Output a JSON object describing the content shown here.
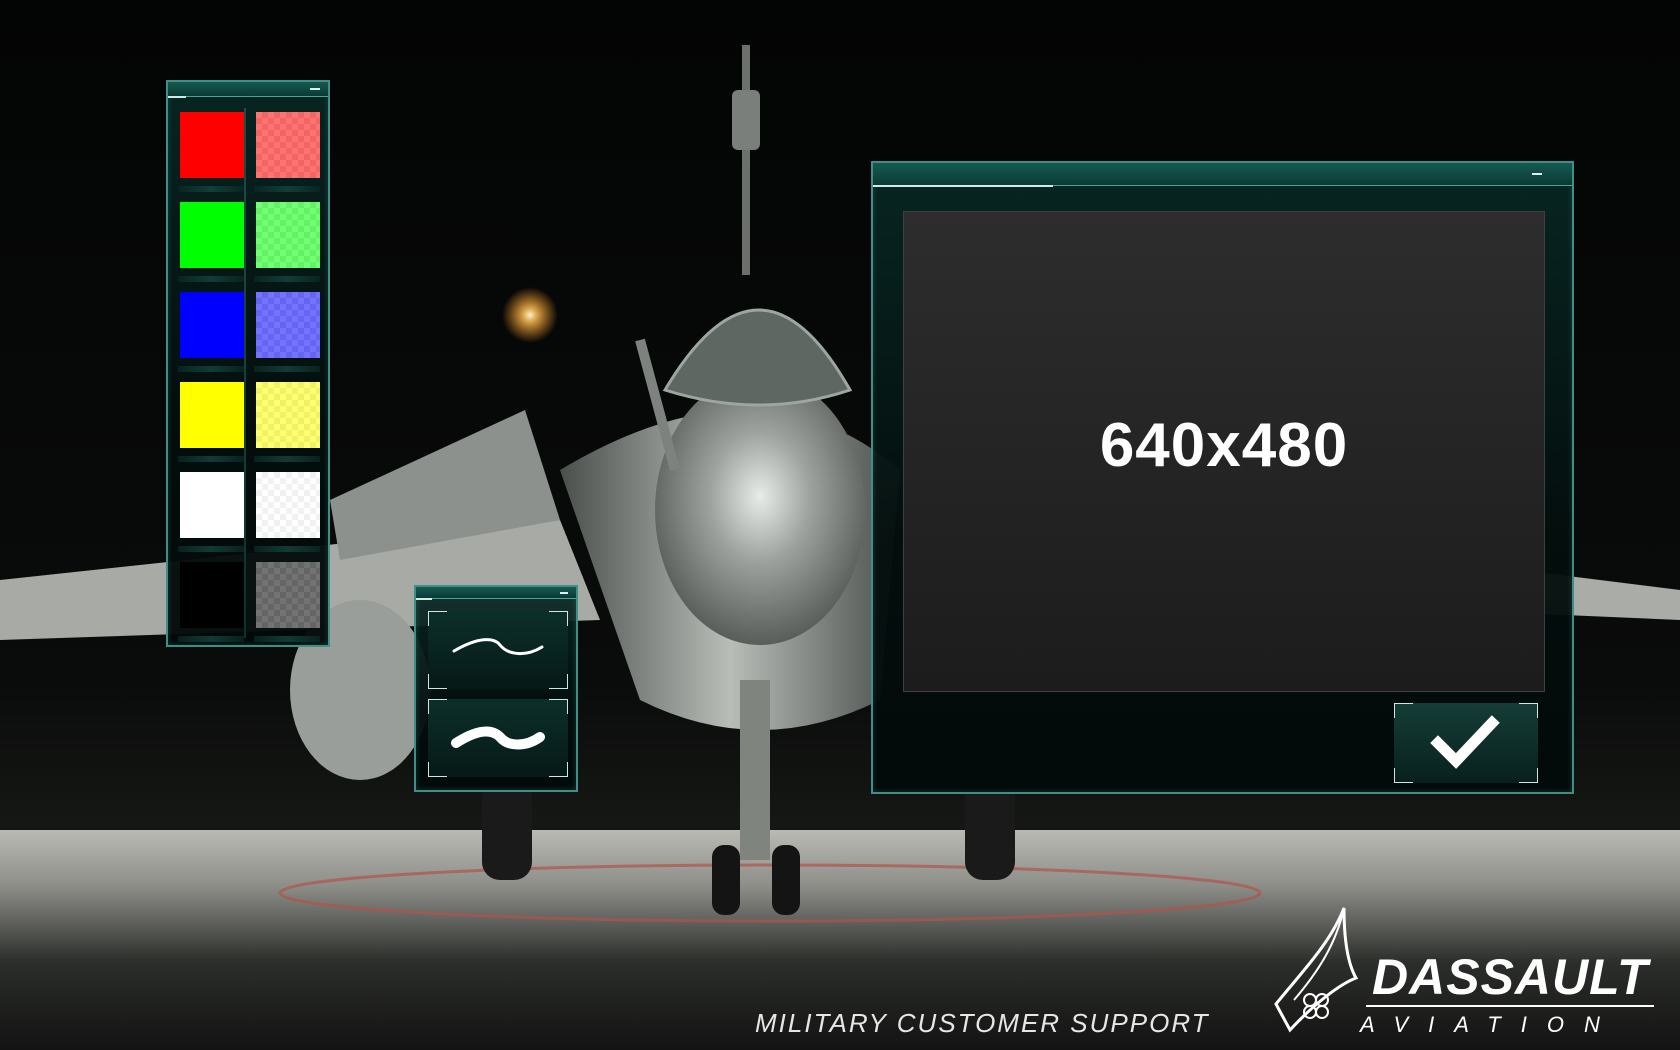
{
  "palette": {
    "swatches": [
      {
        "name": "red",
        "solid": "#ff0000",
        "translucent": "#ff0000"
      },
      {
        "name": "green",
        "solid": "#00ff00",
        "translucent": "#00ff00"
      },
      {
        "name": "blue",
        "solid": "#0000ff",
        "translucent": "#0000ff"
      },
      {
        "name": "yellow",
        "solid": "#ffff00",
        "translucent": "#ffff00"
      },
      {
        "name": "white",
        "solid": "#ffffff",
        "translucent": "#ffffff"
      },
      {
        "name": "black",
        "solid": "#000000",
        "translucent": "#000000"
      }
    ]
  },
  "strokes": {
    "options": [
      {
        "name": "thin-stroke",
        "icon": "thin-wave-icon"
      },
      {
        "name": "thick-stroke",
        "icon": "thick-wave-icon"
      }
    ]
  },
  "preview": {
    "resolution": "640x480",
    "confirm_icon": "checkmark-icon"
  },
  "branding": {
    "tagline": "MILITARY CUSTOMER SUPPORT",
    "brand": "DASSAULT",
    "sub": "AVIATION",
    "logo_icon": "dassault-logo-icon"
  },
  "colors": {
    "panel_border": "#3f8f86",
    "panel_titlebar": "#155a52",
    "accent": "#cfe9e4"
  }
}
